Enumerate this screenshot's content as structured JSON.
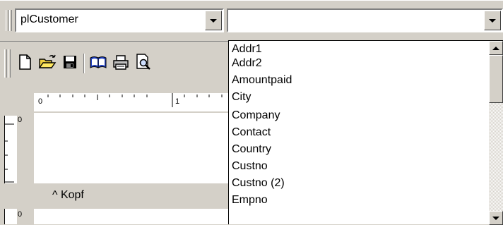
{
  "toolbar_top": {
    "object_combo_value": "plCustomer",
    "field_combo_value": ""
  },
  "field_dropdown": {
    "items": [
      "Addr1",
      "Addr2",
      "Amountpaid",
      "City",
      "Company",
      "Contact",
      "Country",
      "Custno",
      "Custno (2)",
      "Empno"
    ]
  },
  "ruler": {
    "label_0": "0",
    "label_1": "1"
  },
  "left_ruler": {
    "label_0": "0",
    "label_0_b": "0"
  },
  "band": {
    "label": "^ Kopf"
  },
  "toolbar_icons": [
    "new-document-icon",
    "open-folder-icon",
    "save-icon",
    "open-book-icon",
    "print-icon",
    "print-preview-icon"
  ]
}
